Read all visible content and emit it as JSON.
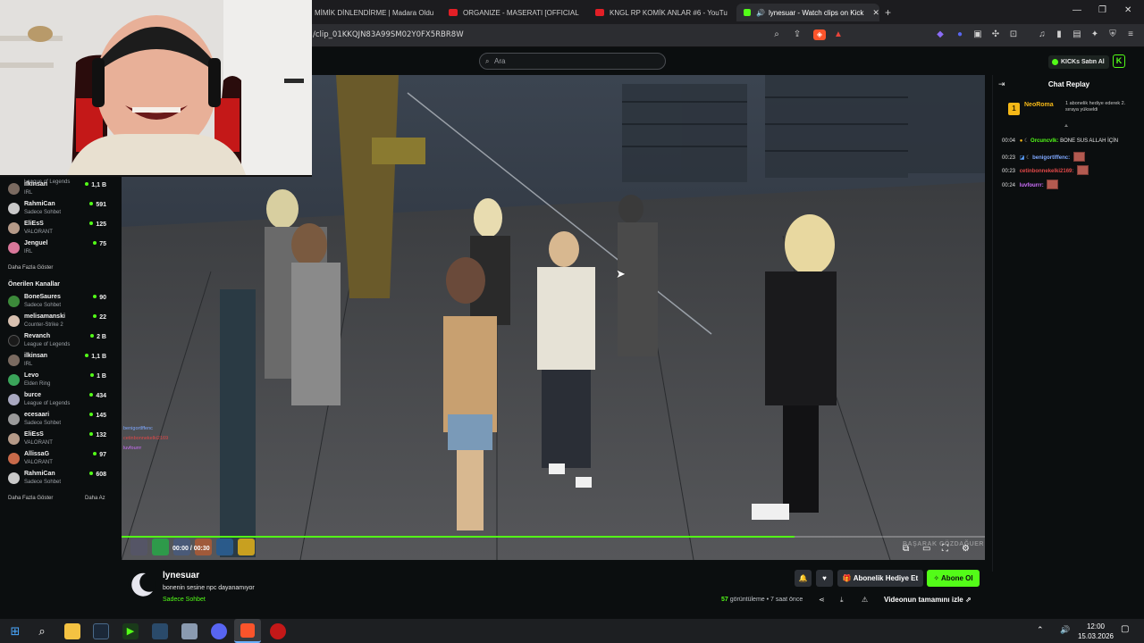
{
  "browser": {
    "tabs": [
      {
        "label": "MİMİK DİNLENDİRME | Madara Oldu"
      },
      {
        "label": "ORGANIZE - MASERATI [OFFICIAL M"
      },
      {
        "label": "KNGL RP KOMİK ANLAR #6 - YouTu"
      },
      {
        "label": "lynesuar - Watch clips on Kick"
      }
    ],
    "new_tab": "+",
    "url": "/clip_01KKQJN83A99SM02Y0FX5RBR8W"
  },
  "kick": {
    "search_placeholder": "Ara",
    "kicks_button": "KICKs Satın Al",
    "sidebar": {
      "top_items": [
        {
          "name": "",
          "category": "League of Legends",
          "viewers": ""
        },
        {
          "name": "ilkinsan",
          "category": "IRL",
          "viewers": "1,1 B"
        },
        {
          "name": "RahmiCan",
          "category": "Sadece Sohbet",
          "viewers": "591"
        },
        {
          "name": "EliEsS",
          "category": "VALORANT",
          "viewers": "125"
        },
        {
          "name": "Jenguel",
          "category": "IRL",
          "viewers": "75"
        }
      ],
      "show_more": "Daha Fazla Göster",
      "recommended_heading": "Önerilen Kanallar",
      "recommended": [
        {
          "name": "BoneSaures",
          "category": "Sadece Sohbet",
          "viewers": "90"
        },
        {
          "name": "melisamanski",
          "category": "Counter-Strike 2",
          "viewers": "22"
        },
        {
          "name": "Revanch",
          "category": "League of Legends",
          "viewers": "2 B"
        },
        {
          "name": "ilkinsan",
          "category": "IRL",
          "viewers": "1,1 B"
        },
        {
          "name": "Levo",
          "category": "Elden Ring",
          "viewers": "1 B"
        },
        {
          "name": "burce",
          "category": "League of Legends",
          "viewers": "434"
        },
        {
          "name": "ecesaari",
          "category": "Sadece Sohbet",
          "viewers": "145"
        },
        {
          "name": "EliEsS",
          "category": "VALORANT",
          "viewers": "132"
        },
        {
          "name": "AllissaG",
          "category": "VALORANT",
          "viewers": "97"
        },
        {
          "name": "RahmiCan",
          "category": "Sadece Sohbet",
          "viewers": "608"
        }
      ],
      "show_more_2": "Daha Fazla Göster",
      "show_less": "Daha Az"
    },
    "player": {
      "time": "00:00 / 00:30",
      "progress": 0.78,
      "watermark": "BAŞARAK GÖZDAĞUER",
      "hud_chat": [
        {
          "user": "benigortlffenc",
          "color": "#7fa8ff"
        },
        {
          "user": "cetinbonnekelki2169",
          "color": "#e04848"
        },
        {
          "user": "luvfourrr",
          "color": "#d070ff"
        }
      ]
    },
    "clip": {
      "channel": "lynesuar",
      "title": "bonenin sesine npc dayanamıyor",
      "category": "Sadece Sohbet",
      "gift_button": "Abonelik Hediye Et",
      "subscribe_button": "Abone Ol",
      "views_count": "57",
      "views_label": "görüntüleme",
      "time_ago": "• 7 saat önce",
      "full_video": "Videonun tamamını izle"
    },
    "chat": {
      "title": "Chat Replay",
      "pinned_user": "NeoRoma",
      "pinned_badge_count": "1",
      "pinned_text": "1 abonelik hediye ederek 2. sıraya yükseldi",
      "messages": [
        {
          "time": "00:04",
          "user": "Orcuncvlk:",
          "user_color": "#53fc18",
          "text": "BONE SUS ALLAH İÇİN"
        },
        {
          "time": "00:23",
          "user": "benigortlffenc:",
          "user_color": "#7fa8ff",
          "text": ""
        },
        {
          "time": "00:23",
          "user": "cetinbonnekelki2169:",
          "user_color": "#e04848",
          "text": ""
        },
        {
          "time": "00:24",
          "user": "luvfourrr:",
          "user_color": "#d070ff",
          "text": ""
        }
      ]
    }
  },
  "taskbar": {
    "time": "12:00",
    "date": "15.03.2026"
  },
  "colors": {
    "kick_green": "#53fc18",
    "background": "#0b0e0f"
  }
}
